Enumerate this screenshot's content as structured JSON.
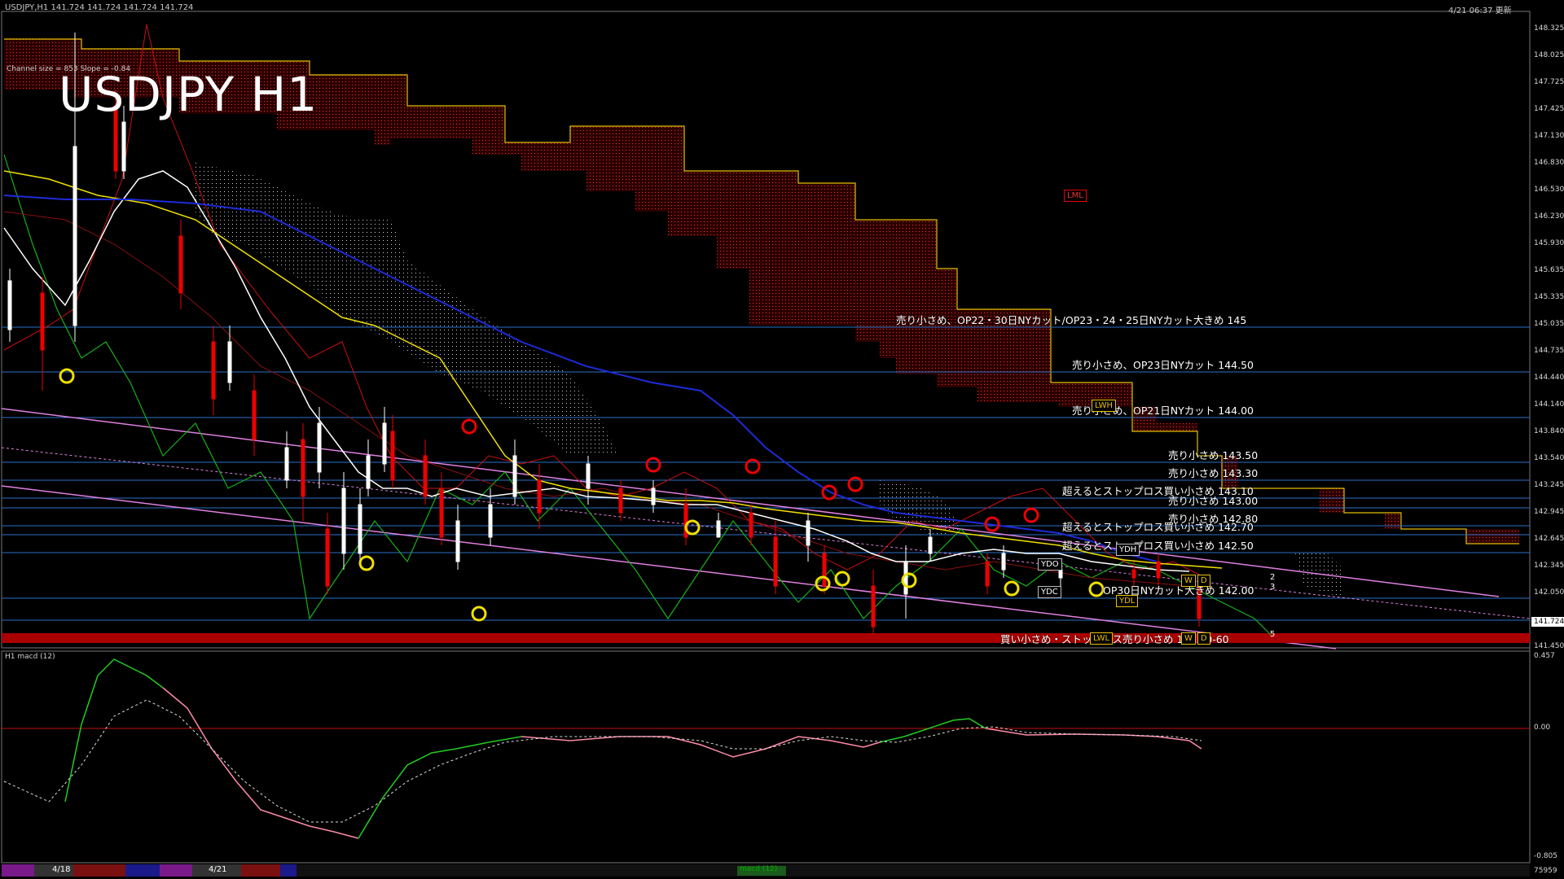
{
  "header": {
    "symbol_info": "USDJPY,H1  141.724 141.724 141.724 141.724",
    "datetime": "4/21 06:37 更新",
    "channel_label": "Channel size = 853 Slope = -0.84",
    "big_title": "USDJPY H1"
  },
  "price_axis": {
    "labels": [
      "148.325",
      "148.025",
      "147.725",
      "147.425",
      "147.130",
      "146.830",
      "146.530",
      "146.230",
      "145.930",
      "145.635",
      "145.335",
      "145.035",
      "144.735",
      "144.440",
      "144.140",
      "143.840",
      "143.540",
      "143.245",
      "142.945",
      "142.645",
      "142.345",
      "142.050",
      "141.450"
    ],
    "current_price": "141.724"
  },
  "levels": [
    {
      "text": "売り小さめ、OP22・30日NYカット/OP23・24・25日NYカット大きめ 145",
      "price": 145.0
    },
    {
      "text": "売り小さめ、OP23日NYカット 144.50",
      "price": 144.5
    },
    {
      "text": "売り小さめ、OP21日NYカット 144.00",
      "price": 144.0
    },
    {
      "text": "売り小さめ 143.50",
      "price": 143.5
    },
    {
      "text": "売り小さめ 143.30",
      "price": 143.3
    },
    {
      "text": "売り小さめ 143.00",
      "price": 143.05
    },
    {
      "text": "超えるとストップロス買い小さめ 143.10",
      "price": 143.1
    },
    {
      "text": "売り小さめ 142.80",
      "price": 142.8
    },
    {
      "text": "超えるとストップロス買い小さめ 142.70",
      "price": 142.7
    },
    {
      "text": "超えるとストップロス買い小さめ 142.50",
      "price": 142.5
    },
    {
      "text": "OP30日NYカット大きめ 142.00",
      "price": 142.0
    },
    {
      "text": "買い小さめ・ストップロス売り小さめ 141.50-60",
      "price": 141.55
    }
  ],
  "tags": {
    "lml": "LML",
    "lwh": "LWH",
    "ydh": "YDH",
    "ydo": "YDO",
    "ydc": "YDC",
    "ydl": "YDL",
    "lwl": "LWL",
    "w": "W",
    "d": "D",
    "num2": "2",
    "num3": "3",
    "num5": "5"
  },
  "macd": {
    "title": "H1  macd (12)",
    "axis_labels": [
      "0.457",
      "0.00",
      "-0.805"
    ],
    "footer_value": "75959"
  },
  "bottom": {
    "dates": [
      "4/18",
      "4/21"
    ],
    "indicator_label": "macd (12)"
  },
  "colors": {
    "background": "#000000",
    "ma_white": "#ffffff",
    "ma_yellow": "#f0e000",
    "ma_blue": "#1e2bd8",
    "ichimoku_red": "#cc1010",
    "chikou_green": "#18b018",
    "channel_pink": "#e080e0",
    "level_line": "#2a6fc8",
    "macd_green": "#22cc22",
    "macd_pink": "#ff8aa8"
  }
}
